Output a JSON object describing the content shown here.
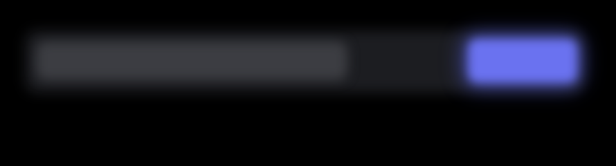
{
  "search": {
    "placeholder": "",
    "value": ""
  },
  "action": {
    "label": ""
  },
  "colors": {
    "background": "#000000",
    "bar": "#1c1d21",
    "input": "#3c3d42",
    "accent": "#6a72f0"
  }
}
